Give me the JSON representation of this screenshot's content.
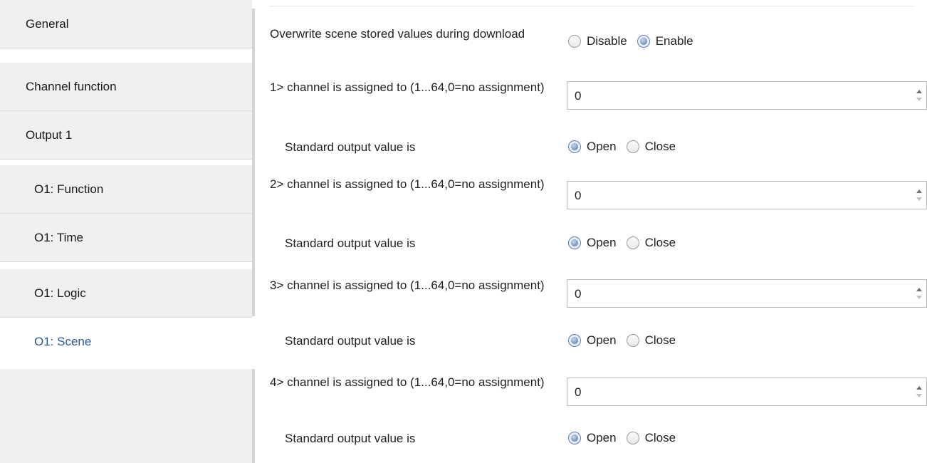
{
  "sidebar": {
    "items": [
      {
        "label": "General"
      },
      {
        "label": "Channel function"
      },
      {
        "label": "Output 1"
      },
      {
        "label": "O1: Function"
      },
      {
        "label": "O1: Time"
      },
      {
        "label": "O1: Logic"
      },
      {
        "label": "O1: Scene",
        "selected": true
      }
    ]
  },
  "params": {
    "overwrite": {
      "label": "Overwrite scene stored values during download",
      "options": [
        "Disable",
        "Enable"
      ],
      "selected": "Enable"
    },
    "channels": [
      {
        "assign_label": "1> channel is assigned to (1...64,0=no assignment)",
        "assign_value": "0",
        "output_label": "Standard output value is",
        "output_options": [
          "Open",
          "Close"
        ],
        "output_selected": "Open"
      },
      {
        "assign_label": "2> channel is assigned to (1...64,0=no assignment)",
        "assign_value": "0",
        "output_label": "Standard output value is",
        "output_options": [
          "Open",
          "Close"
        ],
        "output_selected": "Open"
      },
      {
        "assign_label": "3> channel is assigned to (1...64,0=no assignment)",
        "assign_value": "0",
        "output_label": "Standard output value is",
        "output_options": [
          "Open",
          "Close"
        ],
        "output_selected": "Open"
      },
      {
        "assign_label": "4> channel is assigned to (1...64,0=no assignment)",
        "assign_value": "0",
        "output_label": "Standard output value is",
        "output_options": [
          "Open",
          "Close"
        ],
        "output_selected": "Open"
      }
    ]
  },
  "colors": {
    "selected_text": "#2a5a9c",
    "sidebar_bg": "#f0f0f0",
    "radio_accent": "#6d8fbf"
  },
  "icons": {
    "radio_checked": "radio-checked-icon",
    "radio_unchecked": "radio-unchecked-icon",
    "spin_up": "arrow-up-icon",
    "spin_down": "arrow-down-icon"
  }
}
